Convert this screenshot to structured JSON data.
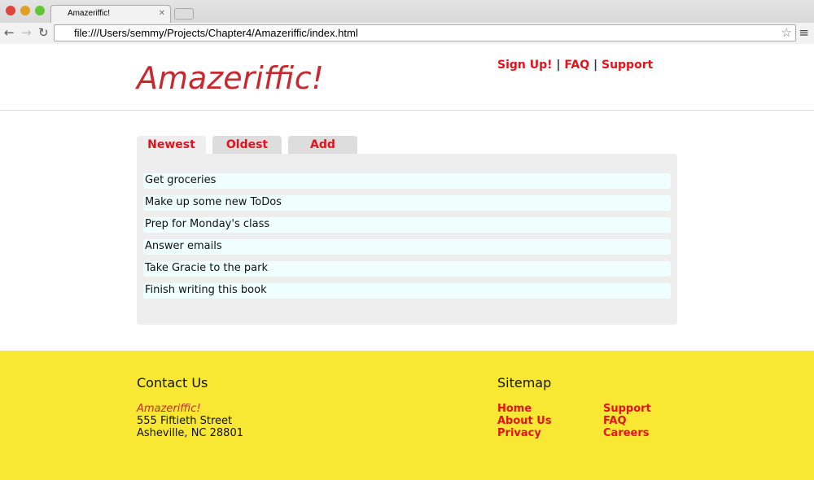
{
  "browser": {
    "tab_title": "Amazeriffic!",
    "url": "file:///Users/semmy/Projects/Chapter4/Amazeriffic/index.html"
  },
  "header": {
    "logo": "Amazeriffic!",
    "links": [
      "Sign Up!",
      "FAQ",
      "Support"
    ],
    "separator": "|"
  },
  "tabs": [
    {
      "label": "Newest",
      "active": true
    },
    {
      "label": "Oldest"
    },
    {
      "label": "Add"
    }
  ],
  "todos": [
    "Get groceries",
    "Make up some new ToDos",
    "Prep for Monday's class",
    "Answer emails",
    "Take Gracie to the park",
    "Finish writing this book"
  ],
  "footer": {
    "contact_title": "Contact Us",
    "company": "Amazeriffic!",
    "street": "555 Fiftieth Street",
    "city": "Asheville, NC 28801",
    "sitemap_title": "Sitemap",
    "sitemap_col1": [
      "Home",
      "About Us",
      "Privacy"
    ],
    "sitemap_col2": [
      "Support",
      "FAQ",
      "Careers"
    ]
  },
  "colors": {
    "accent": "#e4121a",
    "logo": "#c8292f",
    "footer_bg": "#f8e833",
    "todo_bg": "#effffe"
  }
}
